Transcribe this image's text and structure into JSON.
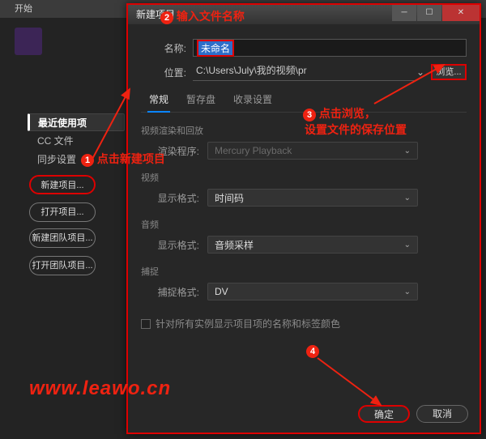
{
  "bg_window": {
    "title": "开始"
  },
  "sidebar": {
    "items": [
      "最近使用项",
      "CC 文件",
      "同步设置"
    ],
    "buttons": [
      "新建项目...",
      "打开项目...",
      "新建团队项目...",
      "打开团队项目..."
    ]
  },
  "dialog": {
    "title": "新建项目",
    "name_label": "名称:",
    "name_value": "未命名",
    "loc_label": "位置:",
    "loc_value": "C:\\Users\\July\\我的视频\\pr",
    "browse": "浏览...",
    "tabs": [
      "常规",
      "暂存盘",
      "收录设置"
    ],
    "sect_render": "视频渲染和回放",
    "render_label": "渲染程序:",
    "render_value": "Mercury Playback",
    "sect_video": "视频",
    "video_label": "显示格式:",
    "video_value": "时间码",
    "sect_audio": "音频",
    "audio_label": "显示格式:",
    "audio_value": "音频采样",
    "sect_capture": "捕捉",
    "capture_label": "捕捉格式:",
    "capture_value": "DV",
    "checkbox": "针对所有实例显示项目项的名称和标签颜色",
    "ok": "确定",
    "cancel": "取消"
  },
  "annotations": {
    "a1": "点击新建项目",
    "a2": "输入文件名称",
    "a3a": "点击浏览，",
    "a3b": "设置文件的保存位置",
    "watermark": "www.leawo.cn"
  }
}
